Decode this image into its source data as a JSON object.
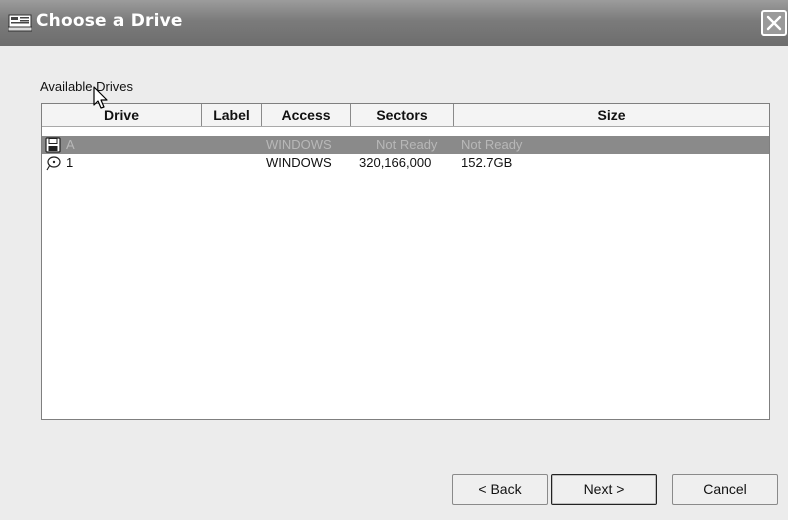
{
  "window": {
    "title": "Choose a Drive"
  },
  "section": {
    "label": "Available Drives"
  },
  "table": {
    "columns": [
      "Drive",
      "Label",
      "Access",
      "Sectors",
      "Size"
    ],
    "rows": [
      {
        "icon": "floppy-disk-icon",
        "drive": "A",
        "label": "",
        "access": "WINDOWS",
        "sectors": "Not Ready",
        "size": "Not Ready",
        "selected": true
      },
      {
        "icon": "hard-disk-icon",
        "drive": "1",
        "label": "",
        "access": "WINDOWS",
        "sectors": "320,166,000",
        "size": "152.7GB",
        "selected": false
      }
    ]
  },
  "buttons": {
    "back": "< Back",
    "next": "Next >",
    "cancel": "Cancel"
  },
  "colors": {
    "titlebar": "#7b7b7b",
    "selection": "#8a8a8a",
    "dialog_bg": "#ececec"
  }
}
